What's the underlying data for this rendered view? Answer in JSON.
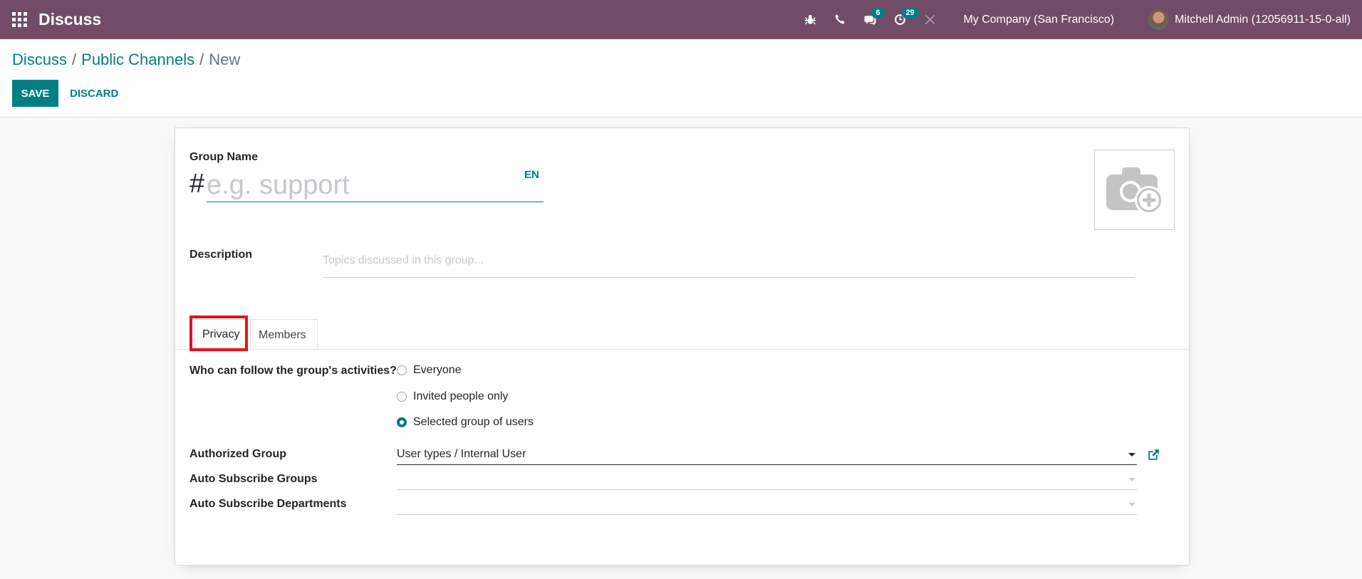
{
  "navbar": {
    "app_title": "Discuss",
    "messages_count": "6",
    "activities_count": "29",
    "company": "My Company (San Francisco)",
    "user": "Mitchell Admin (12056911-15-0-all)"
  },
  "breadcrumb": {
    "discuss": "Discuss",
    "sep": "/",
    "public_channels": "Public Channels",
    "current": "New"
  },
  "actions": {
    "save": "SAVE",
    "discard": "DISCARD"
  },
  "form": {
    "group_name_label": "Group Name",
    "hash": "#",
    "group_name_placeholder": "e.g. support",
    "lang": "EN",
    "description_label": "Description",
    "description_placeholder": "Topics discussed in this group..."
  },
  "tabs": {
    "privacy": "Privacy",
    "members": "Members"
  },
  "privacy": {
    "follow_label": "Who can follow the group's activities?",
    "options": [
      "Everyone",
      "Invited people only",
      "Selected group of users"
    ],
    "selected_option": "Selected group of users",
    "authorized_group_label": "Authorized Group",
    "authorized_group_value": "User types / Internal User",
    "auto_groups_label": "Auto Subscribe Groups",
    "auto_groups_value": "",
    "auto_departments_label": "Auto Subscribe Departments",
    "auto_departments_value": ""
  },
  "colors": {
    "navbar": "#714b67",
    "accent": "#017e84",
    "highlight": "#e0151c"
  }
}
